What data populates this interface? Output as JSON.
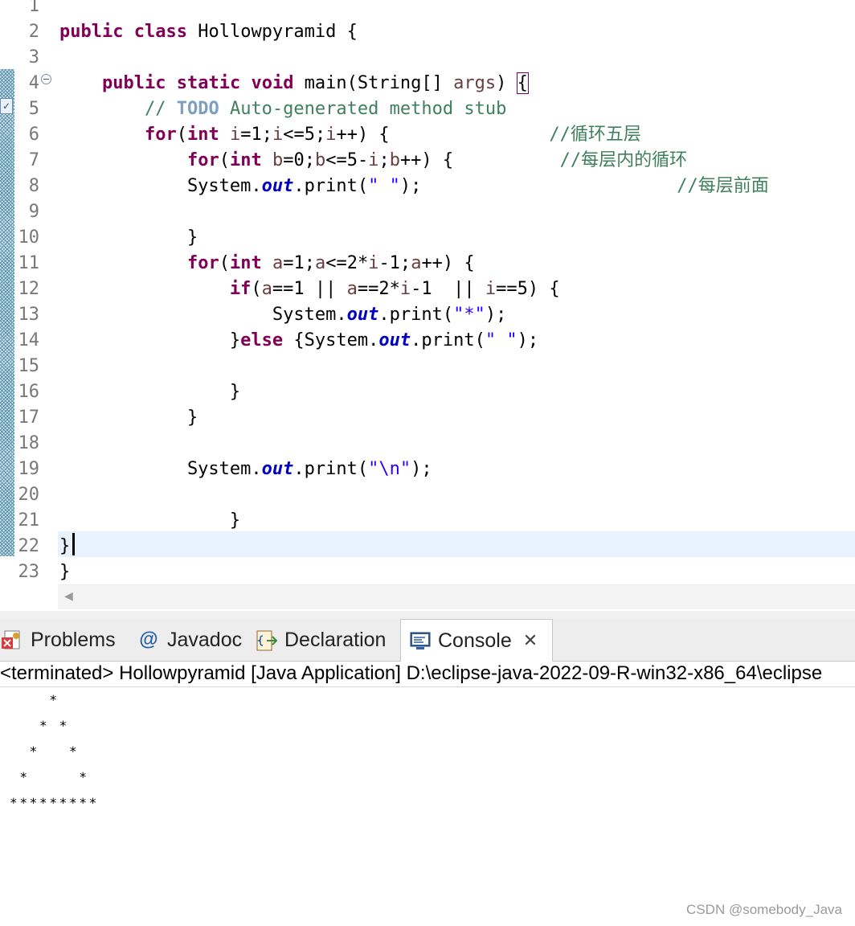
{
  "editor": {
    "lines": [
      {
        "n": "1",
        "parts": []
      },
      {
        "n": "2",
        "parts": [
          [
            "kw",
            "public"
          ],
          [
            "t",
            " "
          ],
          [
            "kw",
            "class"
          ],
          [
            "t",
            " Hollowpyramid {"
          ]
        ]
      },
      {
        "n": "3",
        "parts": []
      },
      {
        "n": "4",
        "parts": [
          [
            "t",
            "    "
          ],
          [
            "kw",
            "public"
          ],
          [
            "t",
            " "
          ],
          [
            "kw",
            "static"
          ],
          [
            "t",
            " "
          ],
          [
            "kw",
            "void"
          ],
          [
            "t",
            " main(String[] "
          ],
          [
            "va",
            "args"
          ],
          [
            "t",
            ") "
          ],
          [
            "bm",
            "{"
          ]
        ]
      },
      {
        "n": "5",
        "parts": [
          [
            "t",
            "        "
          ],
          [
            "cm",
            "// "
          ],
          [
            "todo",
            "TODO"
          ],
          [
            "cm",
            " Auto-generated method stub"
          ]
        ]
      },
      {
        "n": "6",
        "parts": [
          [
            "t",
            "        "
          ],
          [
            "kw",
            "for"
          ],
          [
            "t",
            "("
          ],
          [
            "kw",
            "int"
          ],
          [
            "t",
            " "
          ],
          [
            "va",
            "i"
          ],
          [
            "t",
            "=1;"
          ],
          [
            "va",
            "i"
          ],
          [
            "t",
            "<=5;"
          ],
          [
            "va",
            "i"
          ],
          [
            "t",
            "++) {               "
          ],
          [
            "cm",
            "//循环五层"
          ]
        ]
      },
      {
        "n": "7",
        "parts": [
          [
            "t",
            "            "
          ],
          [
            "kw",
            "for"
          ],
          [
            "t",
            "("
          ],
          [
            "kw",
            "int"
          ],
          [
            "t",
            " "
          ],
          [
            "va",
            "b"
          ],
          [
            "t",
            "=0;"
          ],
          [
            "va",
            "b"
          ],
          [
            "t",
            "<=5-"
          ],
          [
            "va",
            "i"
          ],
          [
            "t",
            ";"
          ],
          [
            "va",
            "b"
          ],
          [
            "t",
            "++) {          "
          ],
          [
            "cm",
            "//每层内的循环"
          ]
        ]
      },
      {
        "n": "8",
        "parts": [
          [
            "t",
            "            System."
          ],
          [
            "fi",
            "out"
          ],
          [
            "t",
            ".print("
          ],
          [
            "st",
            "\" \""
          ],
          [
            "t",
            ");                        "
          ],
          [
            "cm",
            "//每层前面"
          ]
        ]
      },
      {
        "n": "9",
        "parts": []
      },
      {
        "n": "10",
        "parts": [
          [
            "t",
            "            }"
          ]
        ]
      },
      {
        "n": "11",
        "parts": [
          [
            "t",
            "            "
          ],
          [
            "kw",
            "for"
          ],
          [
            "t",
            "("
          ],
          [
            "kw",
            "int"
          ],
          [
            "t",
            " "
          ],
          [
            "va",
            "a"
          ],
          [
            "t",
            "=1;"
          ],
          [
            "va",
            "a"
          ],
          [
            "t",
            "<=2*"
          ],
          [
            "va",
            "i"
          ],
          [
            "t",
            "-1;"
          ],
          [
            "va",
            "a"
          ],
          [
            "t",
            "++) {"
          ]
        ]
      },
      {
        "n": "12",
        "parts": [
          [
            "t",
            "                "
          ],
          [
            "kw",
            "if"
          ],
          [
            "t",
            "("
          ],
          [
            "va",
            "a"
          ],
          [
            "t",
            "==1 || "
          ],
          [
            "va",
            "a"
          ],
          [
            "t",
            "==2*"
          ],
          [
            "va",
            "i"
          ],
          [
            "t",
            "-1  || "
          ],
          [
            "va",
            "i"
          ],
          [
            "t",
            "==5) {"
          ]
        ]
      },
      {
        "n": "13",
        "parts": [
          [
            "t",
            "                    System."
          ],
          [
            "fi",
            "out"
          ],
          [
            "t",
            ".print("
          ],
          [
            "st",
            "\"*\""
          ],
          [
            "t",
            ");"
          ]
        ]
      },
      {
        "n": "14",
        "parts": [
          [
            "t",
            "                }"
          ],
          [
            "kw",
            "else"
          ],
          [
            "t",
            " {System."
          ],
          [
            "fi",
            "out"
          ],
          [
            "t",
            ".print("
          ],
          [
            "st",
            "\" \""
          ],
          [
            "t",
            ");"
          ]
        ]
      },
      {
        "n": "15",
        "parts": []
      },
      {
        "n": "16",
        "parts": [
          [
            "t",
            "                }"
          ]
        ]
      },
      {
        "n": "17",
        "parts": [
          [
            "t",
            "            }"
          ]
        ]
      },
      {
        "n": "18",
        "parts": []
      },
      {
        "n": "19",
        "parts": [
          [
            "t",
            "            System."
          ],
          [
            "fi",
            "out"
          ],
          [
            "t",
            ".print("
          ],
          [
            "st",
            "\"\\n\""
          ],
          [
            "t",
            ");"
          ]
        ]
      },
      {
        "n": "20",
        "parts": []
      },
      {
        "n": "21",
        "parts": [
          [
            "t",
            "                }"
          ]
        ]
      },
      {
        "n": "22",
        "parts": [
          [
            "t",
            "}"
          ]
        ]
      },
      {
        "n": "23",
        "parts": [
          [
            "t",
            "}"
          ]
        ]
      }
    ]
  },
  "icons": {
    "fold": "fold-collapse-icon",
    "task": "task-marker-icon",
    "problems": "problems-icon",
    "javadoc": "javadoc-icon",
    "declaration": "declaration-icon",
    "console": "console-icon",
    "close": "close-icon"
  },
  "tabs": {
    "problems": "Problems",
    "javadoc": "Javadoc",
    "javadoc_symbol": "@",
    "declaration": "Declaration",
    "console": "Console",
    "close_glyph": "✕"
  },
  "console": {
    "status": "<terminated> Hollowpyramid [Java Application] D:\\eclipse-java-2022-09-R-win32-x86_64\\eclipse",
    "output": [
      "    *",
      "   * *",
      "  *   *",
      " *     *",
      "*********"
    ]
  },
  "watermark": "CSDN @somebody_Java",
  "colors": {
    "keyword": "#7f0055",
    "comment": "#3f7f5f",
    "string": "#2a00ff",
    "field": "#0000c0",
    "current_line": "#e8f2fe"
  }
}
